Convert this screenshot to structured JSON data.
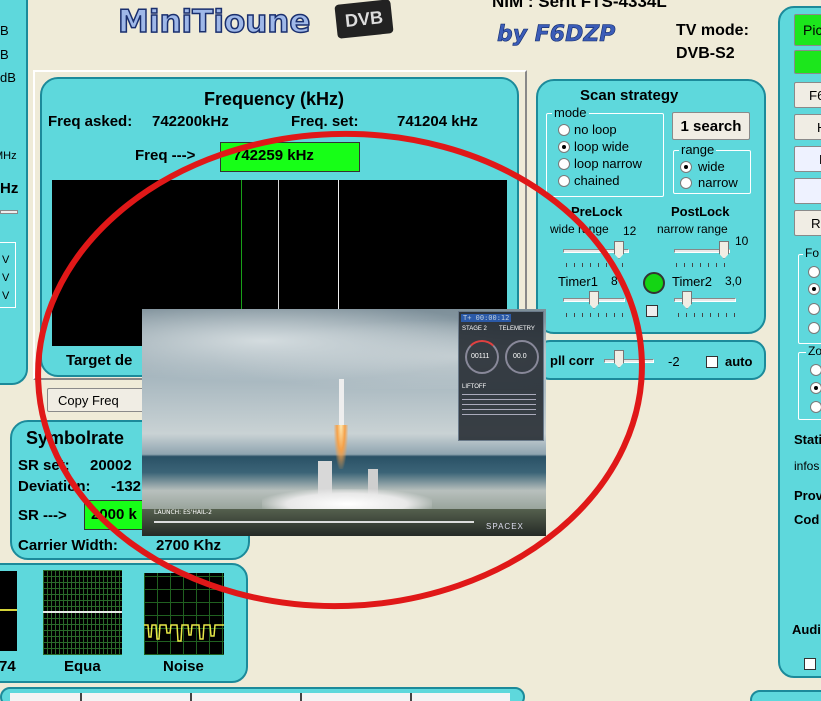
{
  "header": {
    "logo_text": "MiniTioune",
    "logo_badge": "DVB",
    "byline": "by F6DZP",
    "nim_text": "NIM : Serit FTS-4334L",
    "tv_mode_label": "TV mode:",
    "tv_mode_value": "DVB-S2"
  },
  "left_edge": {
    "line_b": "B",
    "line_db": "dB",
    "line_mhz": "MHz",
    "line_hz": "Hz",
    "v1": "V",
    "v2": "V",
    "v3": "V"
  },
  "frequency": {
    "title": "Frequency (kHz)",
    "asked_label": "Freq asked:",
    "asked_value": "742200kHz",
    "set_label": "Freq. set:",
    "set_value": "741204 kHz",
    "freq_arrow_label": "Freq --->",
    "freq_value": "742259 kHz",
    "target_label": "Target de",
    "copy_button": "Copy Freq"
  },
  "scan": {
    "title": "Scan strategy",
    "mode_label": "mode",
    "modes": [
      "no loop",
      "loop wide",
      "loop narrow",
      "chained"
    ],
    "selected_mode": "loop wide",
    "search_button": "1 search",
    "range_label": "range",
    "ranges": [
      "wide",
      "narrow"
    ],
    "selected_range": "wide",
    "prelock_label": "PreLock",
    "prelock_range_label": "wide range",
    "prelock_value": "12",
    "postlock_label": "PostLock",
    "postlock_range_label": "narrow range",
    "postlock_value": "10",
    "timer1_label": "Timer1",
    "timer1_value": "8",
    "timer2_label": "Timer2",
    "timer2_value": "3,0",
    "pll_label": "pll corr",
    "pll_value": "-2",
    "auto_label": "auto"
  },
  "symbolrate": {
    "title": "Symbolrate",
    "sr_set_label": "SR set:",
    "sr_set_value": "20002",
    "deviation_label": "Deviation:",
    "deviation_value": "-132",
    "sr_arrow_label": "SR --->",
    "sr_value": "2000 k",
    "carrier_label": "Carrier Width:",
    "carrier_value": "2700 Khz"
  },
  "scopes": {
    "left_label": "74",
    "equa_label": "Equa",
    "noise_label": "Noise"
  },
  "right_panel": {
    "btn1": "Pic",
    "btn3": "F6",
    "btn4": "H",
    "btn5": "F",
    "btn7": "R",
    "group1_label": "Fo",
    "group2_label": "Zo",
    "station_label": "Stati",
    "infos_label": "infos",
    "prov_label": "Prov",
    "cod_label": "Cod",
    "audio_label": "Audi"
  },
  "video_overlay": {
    "stage": "STAGE 2",
    "telemetry": "TELEMETRY",
    "time": "T+ 00:00:12",
    "speed_val": "00111",
    "alt_val": "00.0",
    "liftoff": "LIFTOFF",
    "launch_caption": "LAUNCH: ES'HAIL-2",
    "brand": "SPACEX"
  },
  "colors": {
    "panel": "#5ed8dc",
    "panel_border": "#1c8a9a",
    "green_field": "#17ff17",
    "annotation_circle": "#e01818",
    "background": "#efebd8"
  }
}
